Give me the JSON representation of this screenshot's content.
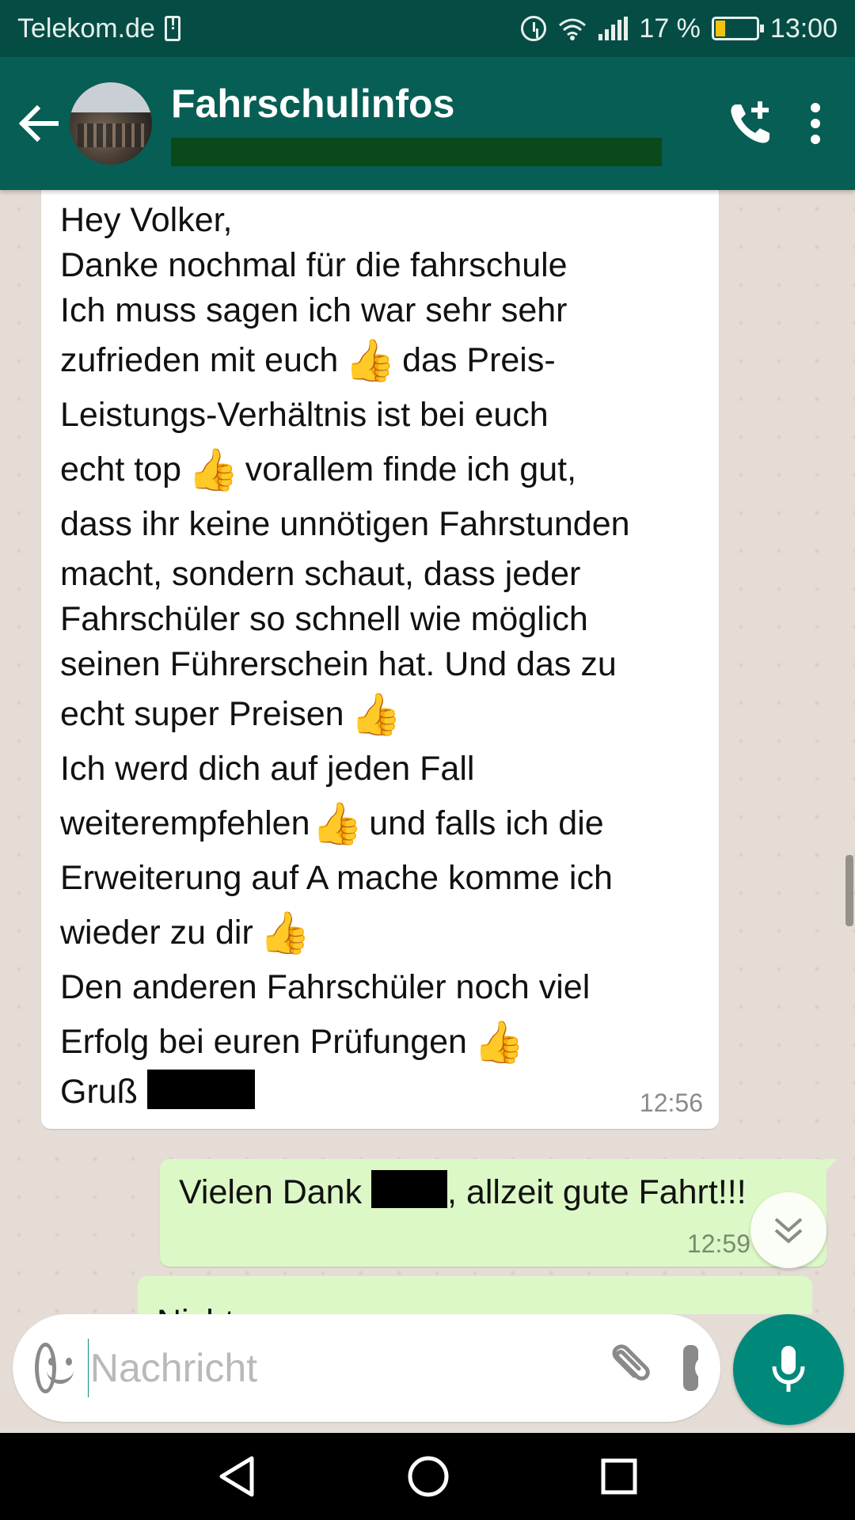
{
  "statusbar": {
    "carrier": "Telekom.de",
    "battery": "17 %",
    "time": "13:00"
  },
  "appbar": {
    "title": "Fahrschulinfos"
  },
  "messages": {
    "incoming": {
      "lines": [
        "Hey Volker,",
        "Danke nochmal für die fahrschule",
        "Ich muss sagen ich war sehr sehr",
        "zufrieden mit euch",
        "das Preis-",
        "Leistungs-Verhältnis ist bei euch",
        "echt top",
        "vorallem finde ich gut,",
        "dass ihr keine unnötigen Fahrstunden",
        "macht, sondern schaut, dass jeder",
        "Fahrschüler so schnell wie möglich",
        "seinen Führerschein hat. Und das zu",
        "echt super Preisen",
        "Ich werd dich auf jeden Fall",
        "weiterempfehlen",
        "und falls ich die",
        "Erweiterung auf A mache komme ich",
        "wieder zu dir",
        "Den anderen Fahrschüler noch viel",
        "Erfolg bei euren Prüfungen",
        "Gruß"
      ],
      "emoji": "👍",
      "time": "12:56"
    },
    "outgoing": {
      "text_before": "Vielen Dank",
      "text_after": ", allzeit gute Fahrt!!!",
      "time": "12:59"
    },
    "outgoing_partial": {
      "text": "Nicht vergessen"
    }
  },
  "input": {
    "placeholder": "Nachricht"
  },
  "colors": {
    "header": "#075e54",
    "statusbar": "#054d44",
    "outgoing_bubble": "#dcf8c6",
    "accent": "#00897b",
    "chat_bg": "#e5ddd5"
  },
  "icons": [
    "back-arrow-icon",
    "add-call-icon",
    "more-vert-icon",
    "emoji-icon",
    "attach-icon",
    "camera-icon",
    "mic-icon",
    "chevron-down-icon",
    "nav-back-icon",
    "nav-home-icon",
    "nav-recents-icon"
  ]
}
